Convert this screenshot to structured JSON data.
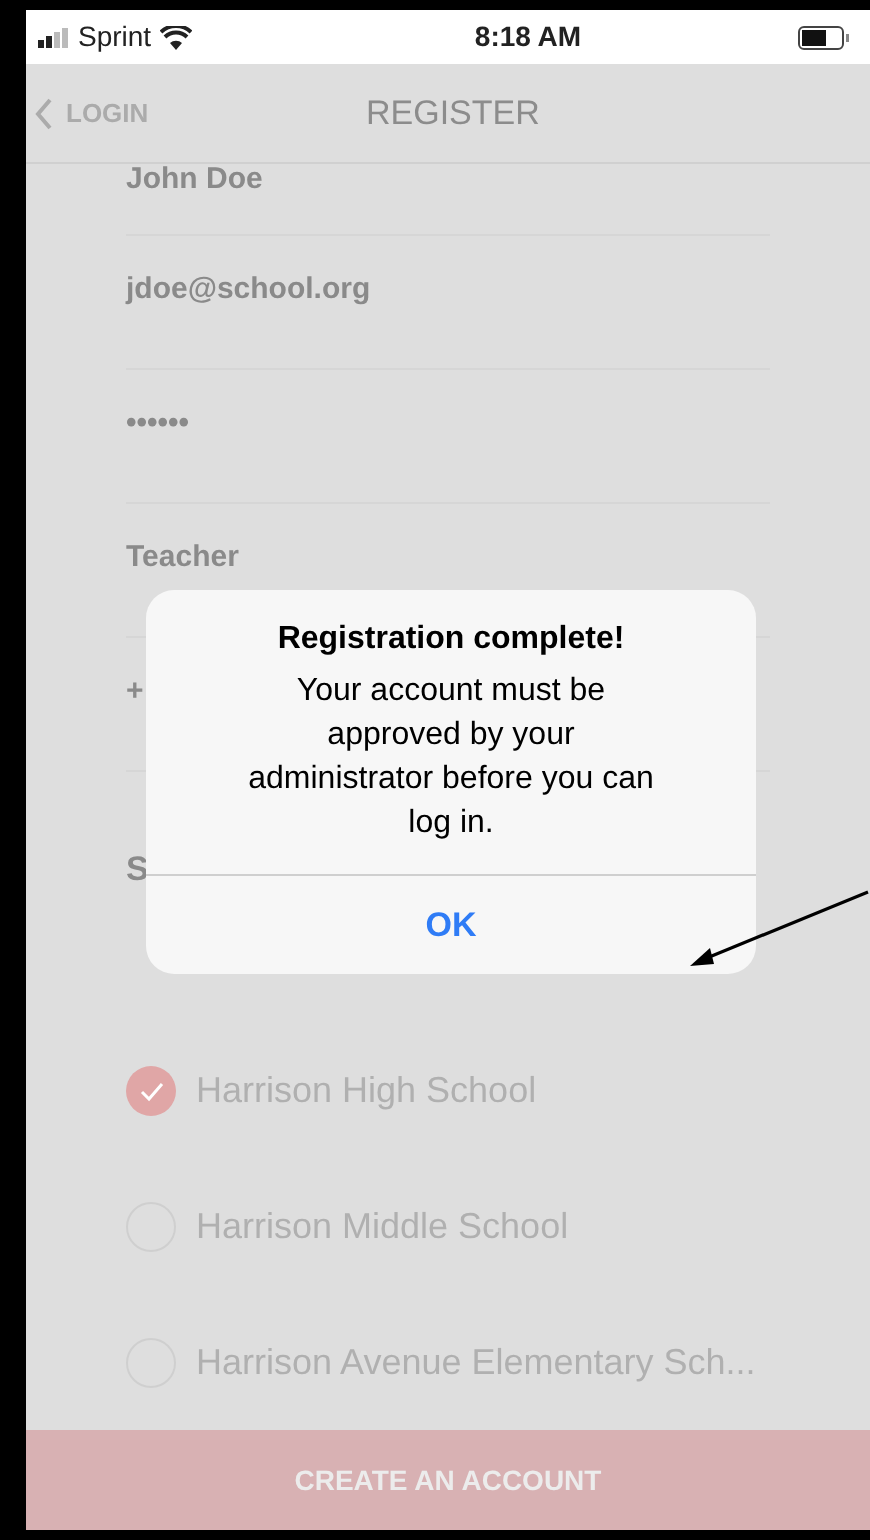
{
  "status_bar": {
    "carrier": "Sprint",
    "time": "8:18 AM"
  },
  "nav": {
    "back": "LOGIN",
    "title": "REGISTER"
  },
  "fields": [
    {
      "value": "John Doe"
    },
    {
      "value": "jdoe@school.org"
    },
    {
      "value": "••••••"
    },
    {
      "value": "Teacher"
    },
    {
      "value": "+"
    }
  ],
  "buildings": {
    "heading": "S",
    "items": [
      {
        "name": "Harrison High School",
        "checked": true
      },
      {
        "name": "Harrison Middle School",
        "checked": false
      },
      {
        "name": "Harrison Avenue Elementary Sch...",
        "checked": false
      }
    ]
  },
  "submit": "CREATE AN ACCOUNT",
  "alert": {
    "title": "Registration complete!",
    "message": "Your account must be approved by your administrator before you can log in.",
    "button": "OK"
  }
}
